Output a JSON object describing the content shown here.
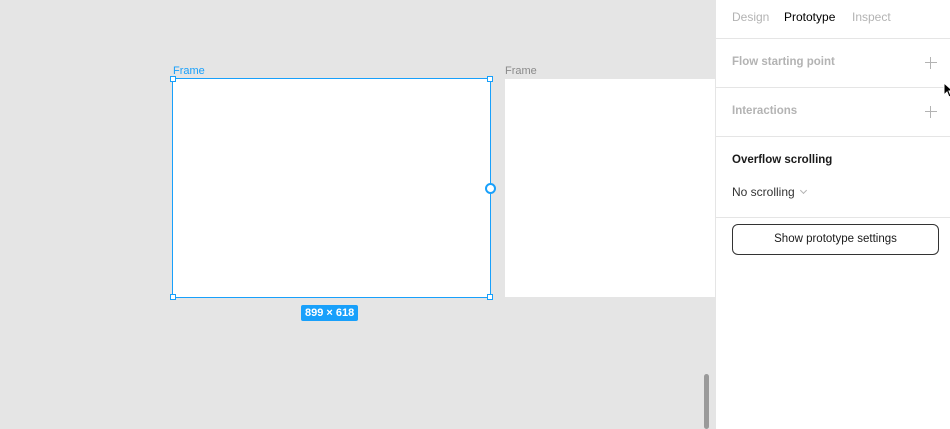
{
  "canvas": {
    "frames": [
      {
        "label": "Frame",
        "selected": true
      },
      {
        "label": "Frame",
        "selected": false
      }
    ],
    "size_badge": "899 × 618"
  },
  "panel": {
    "tabs": [
      {
        "label": "Design",
        "active": false
      },
      {
        "label": "Prototype",
        "active": true
      },
      {
        "label": "Inspect",
        "active": false
      }
    ],
    "flow_starting_point": "Flow starting point",
    "interactions": "Interactions",
    "overflow_scrolling": {
      "title": "Overflow scrolling",
      "selected": "No scrolling"
    },
    "show_settings_button": "Show prototype settings"
  },
  "colors": {
    "accent": "#18a0fb",
    "canvas_bg": "#e5e5e5",
    "panel_bg": "#ffffff",
    "muted_text": "#b3b3b3"
  },
  "icons": [
    "plus-icon",
    "chevron-down-icon",
    "mouse-cursor-icon"
  ]
}
